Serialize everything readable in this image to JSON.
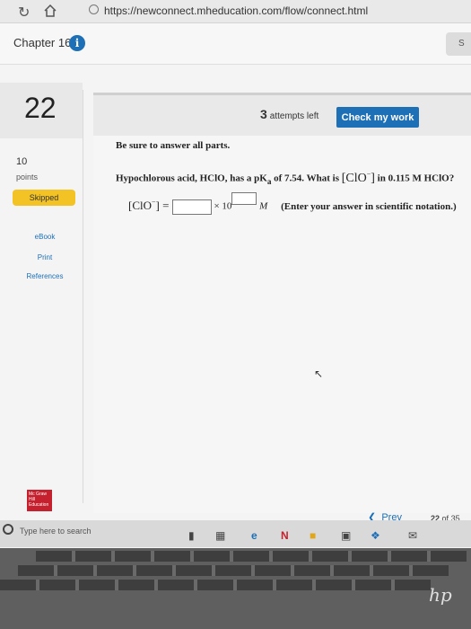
{
  "browser": {
    "url": "https://newconnect.mheducation.com/flow/connect.html",
    "icons": [
      "reload-icon",
      "home-icon",
      "lock-icon"
    ]
  },
  "header": {
    "chapter": "Chapter 16",
    "info": "i",
    "right_tab": "S"
  },
  "sidebar": {
    "question_number": "22",
    "points_value": "10",
    "points_label": "points",
    "status": "Skipped",
    "links": [
      "eBook",
      "Print",
      "References"
    ]
  },
  "question_header": {
    "attempts_count": "3",
    "attempts_label": "attempts left",
    "check_button": "Check my work"
  },
  "question": {
    "instruction": "Be sure to answer all parts.",
    "text_pre": "Hypochlorous acid, HClO, has a pK",
    "text_sub": "a",
    "text_mid": " of 7.54. What is ",
    "text_species": "[ClO",
    "text_charge": "−",
    "text_close": "]",
    "text_post": " in 0.115 M HClO?",
    "answer_lhs": "[ClO",
    "answer_charge": "−",
    "answer_eq": "] = ",
    "times_ten": "× 10",
    "unit": "M",
    "hint": "(Enter your answer in scientific notation.)",
    "answer_value": "",
    "answer_exponent": ""
  },
  "footer": {
    "logo": "Mc Graw Hill Education",
    "prev": "Prev",
    "page_current": "22",
    "page_of": "of",
    "page_total": "35"
  },
  "taskbar": {
    "search_placeholder": "Type here to search"
  },
  "laptop": {
    "brand": "hp"
  },
  "colors": {
    "accent": "#1d6fb6",
    "skipped": "#f3c326",
    "logo_red": "#c5202e"
  }
}
